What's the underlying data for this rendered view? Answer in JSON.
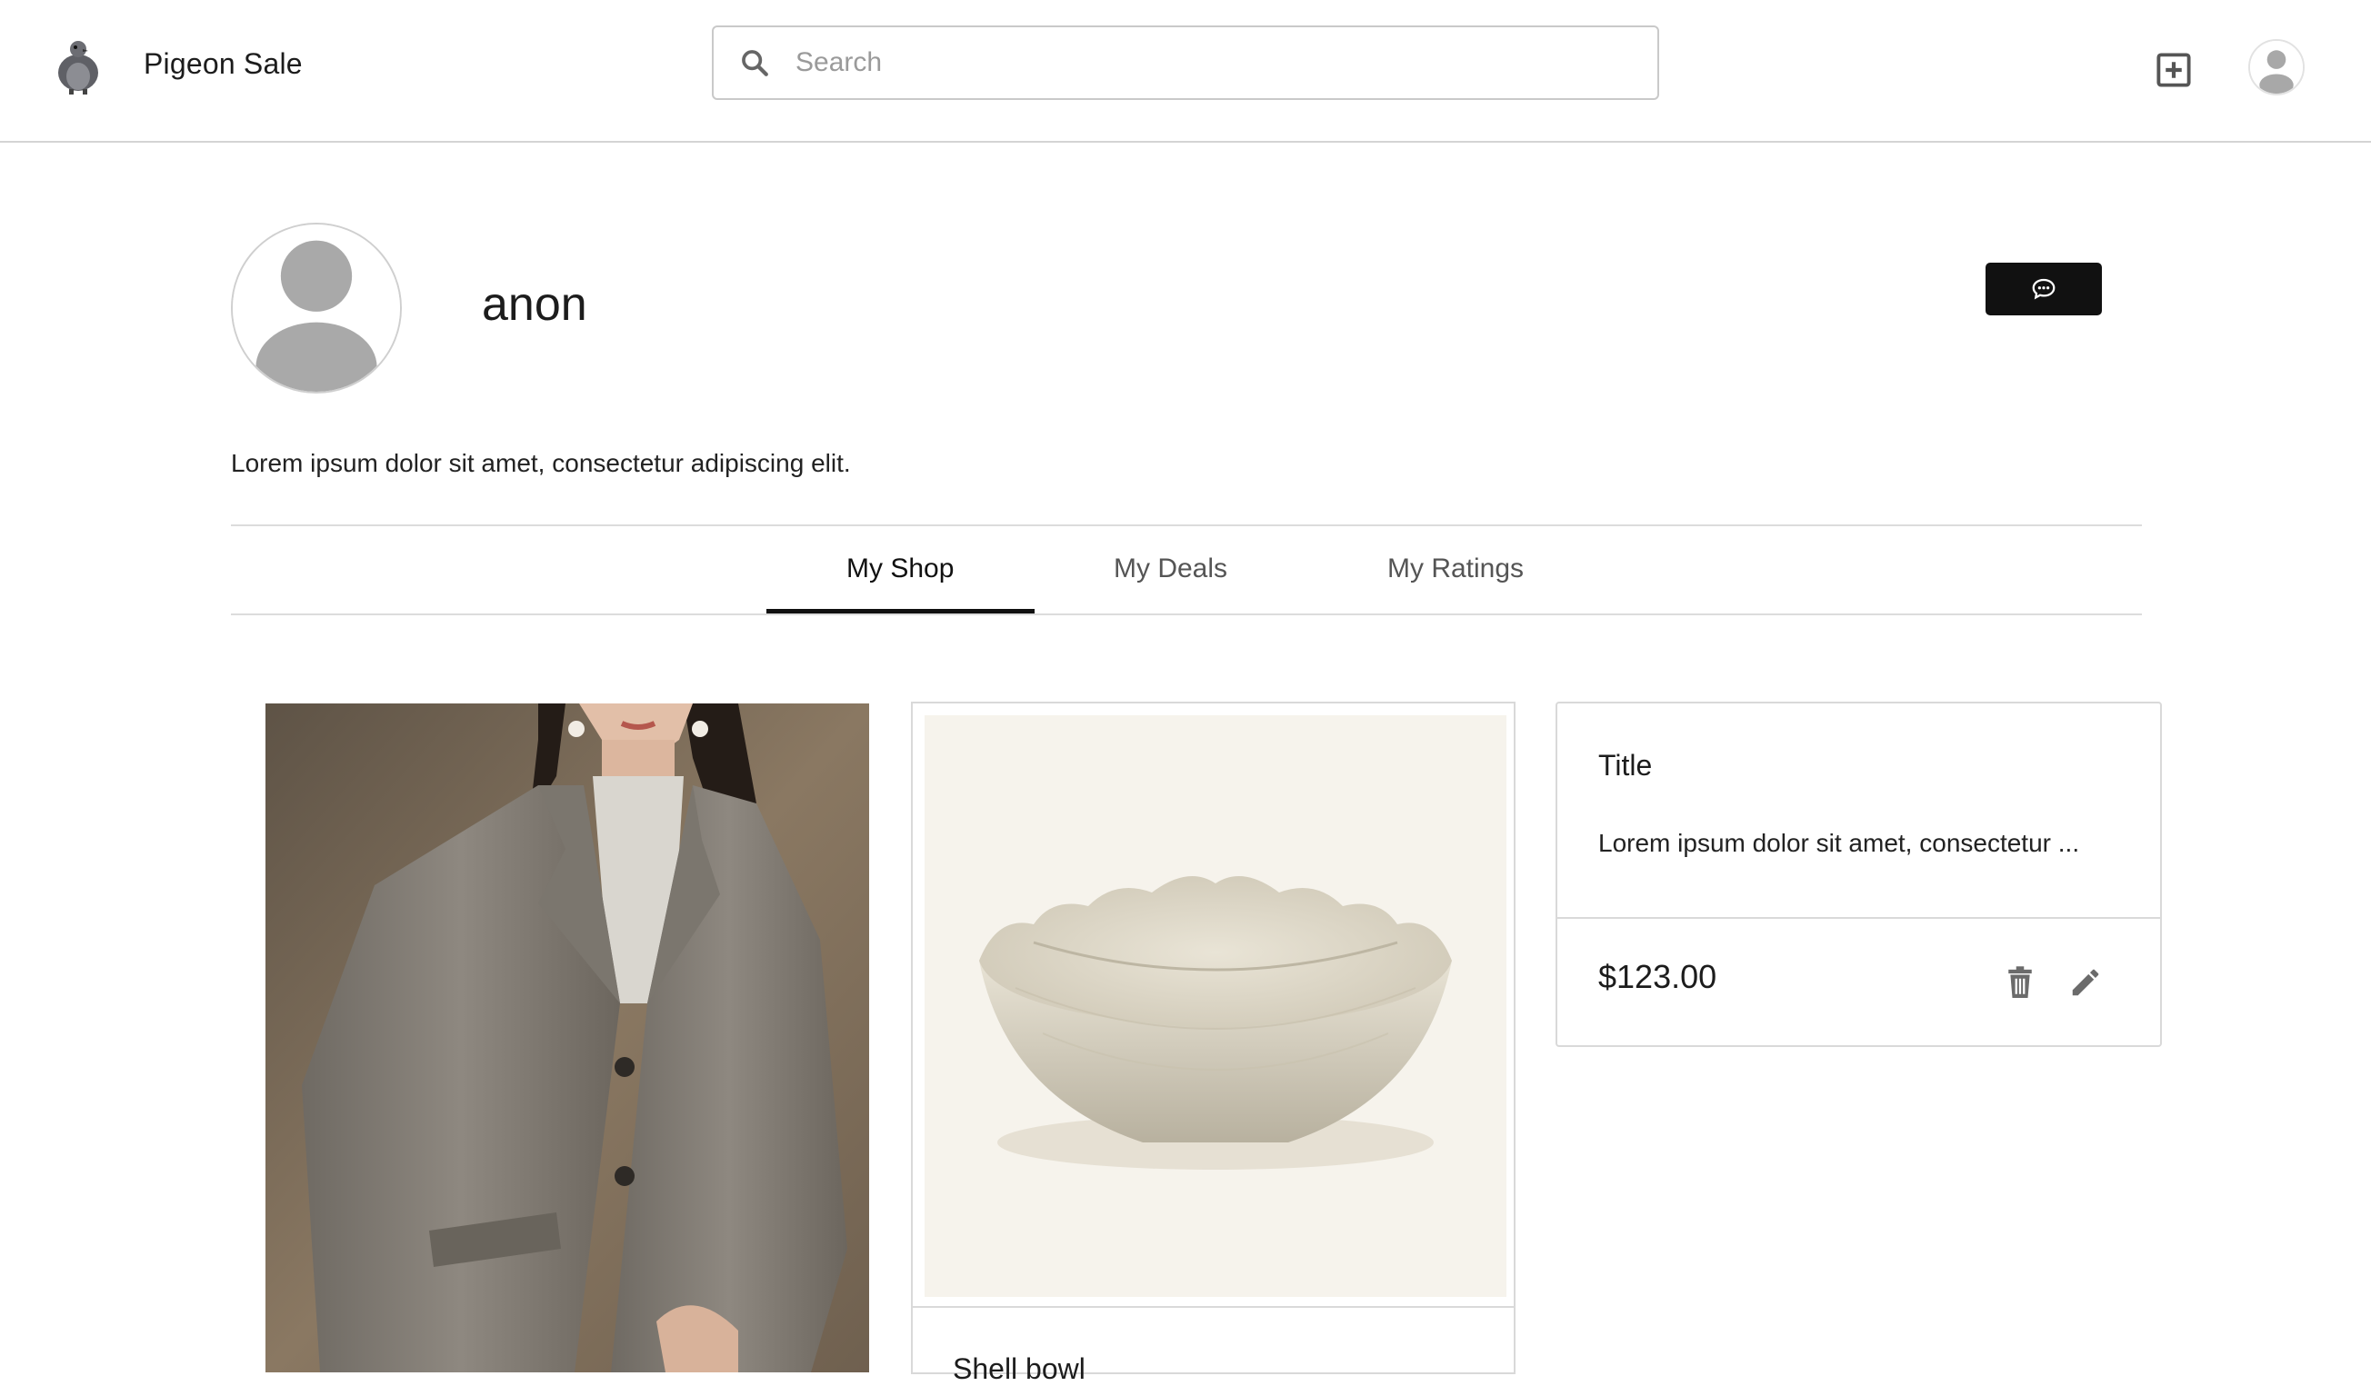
{
  "header": {
    "brand": "Pigeon Sale",
    "search_placeholder": "Search",
    "add_icon": "plus-square-icon",
    "avatar_icon": "user-icon"
  },
  "profile": {
    "username": "anon",
    "bio": "Lorem ipsum dolor sit amet, consectetur adipiscing elit.",
    "message_icon": "chat-icon"
  },
  "tabs": [
    {
      "label": "My Shop",
      "active": true
    },
    {
      "label": "My Deals",
      "active": false
    },
    {
      "label": "My Ratings",
      "active": false
    }
  ],
  "listings": {
    "bowl_title": "Shell bowl",
    "item": {
      "title": "Title",
      "description": "Lorem ipsum dolor sit amet, consectetur ...",
      "price": "$123.00"
    }
  },
  "colors": {
    "primary_button": "#111111",
    "border": "#d9d9d9",
    "muted_icon": "#6b6b6b"
  }
}
